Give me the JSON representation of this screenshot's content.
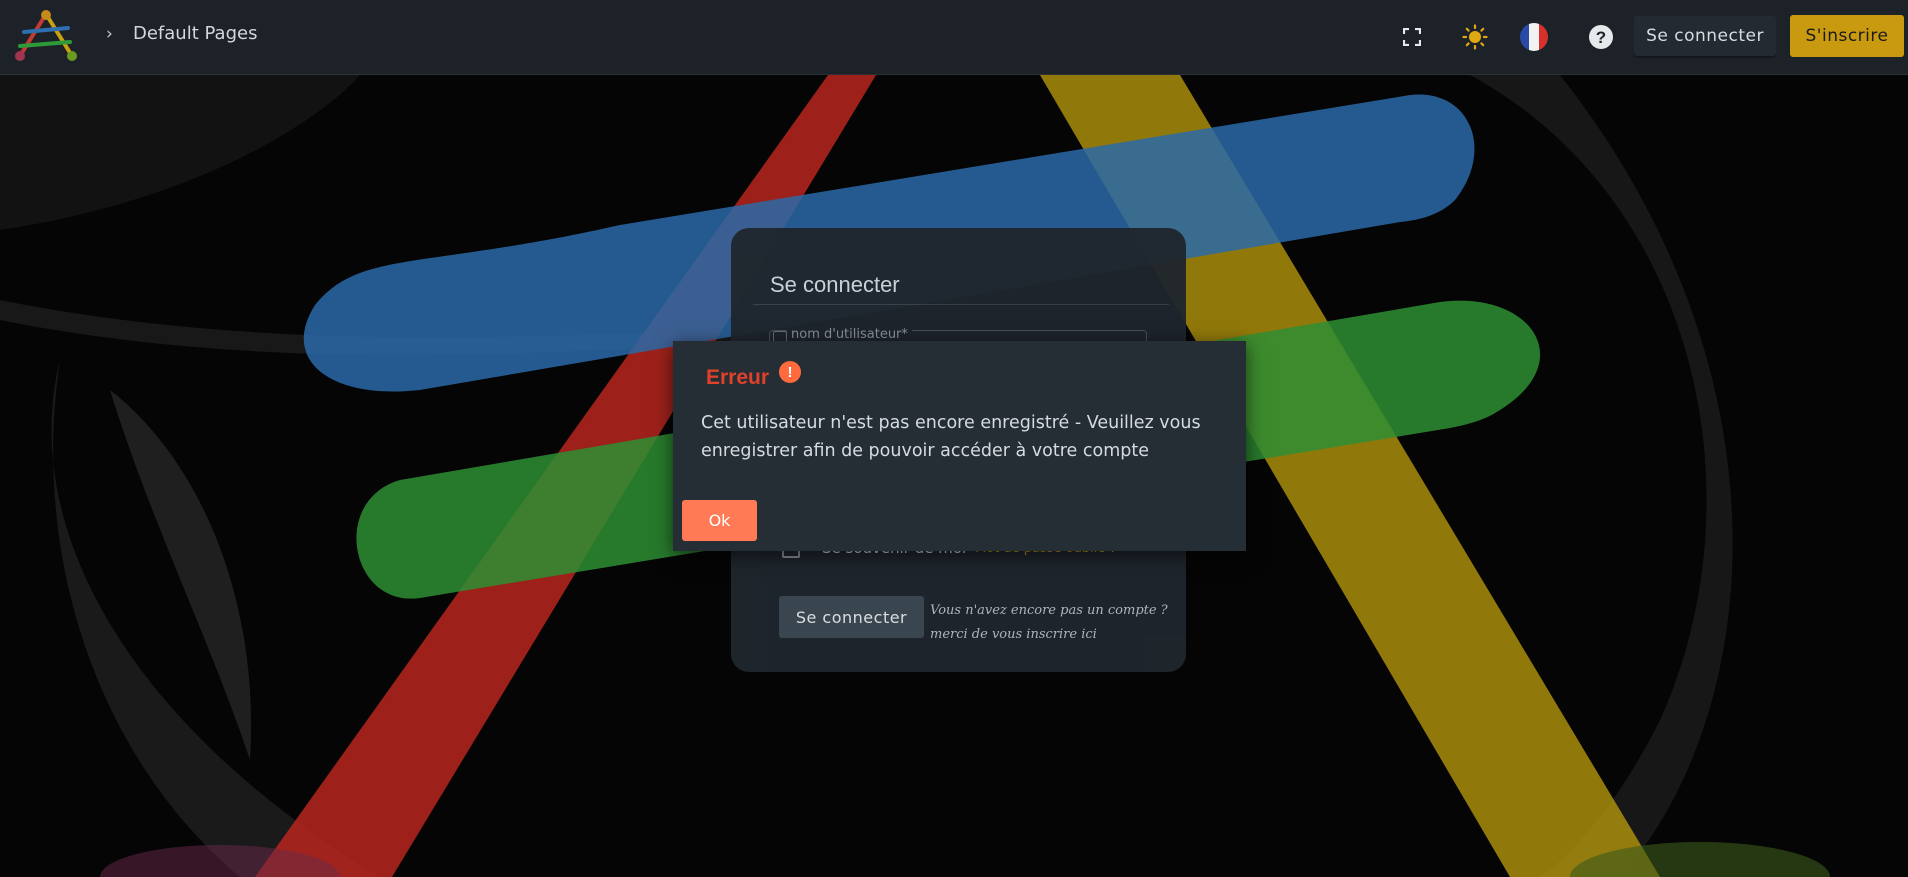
{
  "header": {
    "breadcrumb": "Default Pages",
    "login_label": "Se connecter",
    "signup_label": "S'inscrire",
    "icons": [
      "fullscreen-icon",
      "sun-icon",
      "france-flag-icon",
      "help-icon"
    ]
  },
  "login_card": {
    "title": "Se connecter",
    "username_label": "nom d'utilisateur*",
    "remember_label": "Se souvenir de moi",
    "forgot_link": "Mot de passe oublié ?",
    "submit_label": "Se connecter",
    "no_account_line1": "Vous n'avez encore pas un compte ?",
    "no_account_line2": "merci de vous inscrire ici"
  },
  "dialog": {
    "title": "Erreur",
    "icon_glyph": "!",
    "message": "Cet utilisateur n'est pas encore enregistré - Veuillez vous enregistrer afin de pouvoir accéder à votre compte",
    "ok_label": "Ok"
  },
  "colors": {
    "brand_yellow": "#c99a0f",
    "error_red": "#e0412a",
    "ok_orange": "#ff7a55"
  }
}
